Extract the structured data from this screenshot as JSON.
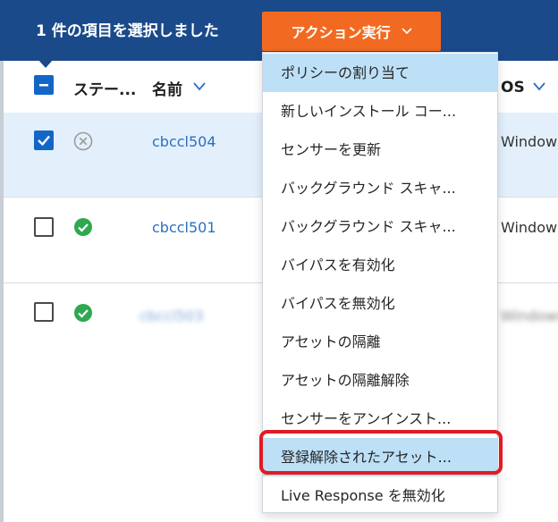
{
  "selection_bar": {
    "count": "1",
    "text": " 件の項目を選択しました",
    "action_button": "アクション実行"
  },
  "columns": {
    "status": "ステー...",
    "name": "名前",
    "os": "OS"
  },
  "rows": [
    {
      "name": "cbccl504",
      "os": "Windows",
      "status": "inactive",
      "checked": true
    },
    {
      "name": "cbccl501",
      "os": "Windows",
      "status": "active",
      "checked": false
    },
    {
      "name": "cbccl503",
      "os": "Windows",
      "status": "active",
      "checked": false
    }
  ],
  "menu": {
    "items": [
      "ポリシーの割り当て",
      "新しいインストール コー...",
      "センサーを更新",
      "バックグラウンド スキャ...",
      "バックグラウンド スキャ...",
      "バイパスを有効化",
      "バイパスを無効化",
      "アセットの隔離",
      "アセットの隔離解除",
      "センサーをアンインスト...",
      "登録解除されたアセット...",
      "Live Response を無効化"
    ]
  },
  "colors": {
    "header_bg": "#1a4a8a",
    "action_button": "#f26a21",
    "link": "#2a6fbf",
    "highlight": "#bde0f7",
    "callout": "#e11b22"
  }
}
